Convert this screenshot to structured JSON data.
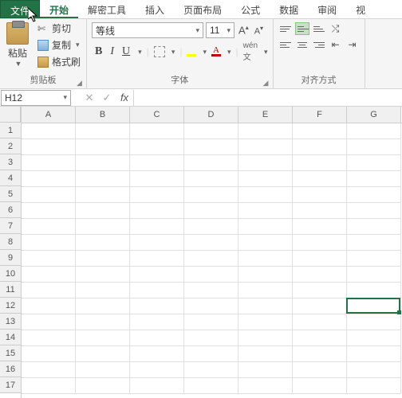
{
  "tabs": {
    "file": "文件",
    "home": "开始",
    "crack": "解密工具",
    "insert": "插入",
    "layout": "页面布局",
    "formulas": "公式",
    "data": "数据",
    "review": "审阅",
    "view": "视"
  },
  "clipboard": {
    "paste": "粘贴",
    "cut": "剪切",
    "copy": "复制",
    "brush": "格式刷",
    "group": "剪贴板"
  },
  "font": {
    "name": "等线",
    "size": "11",
    "group": "字体"
  },
  "align": {
    "group": "对齐方式"
  },
  "namebox": "H12",
  "columns": [
    "A",
    "B",
    "C",
    "D",
    "E",
    "F",
    "G"
  ],
  "rows": [
    "1",
    "2",
    "3",
    "4",
    "5",
    "6",
    "7",
    "8",
    "9",
    "10",
    "11",
    "12",
    "13",
    "14",
    "15",
    "16",
    "17"
  ],
  "selection": {
    "row": 12,
    "colIndex": 7
  },
  "colors": {
    "accent": "#217346",
    "fill": "#ffff00",
    "text": "#c00000"
  }
}
